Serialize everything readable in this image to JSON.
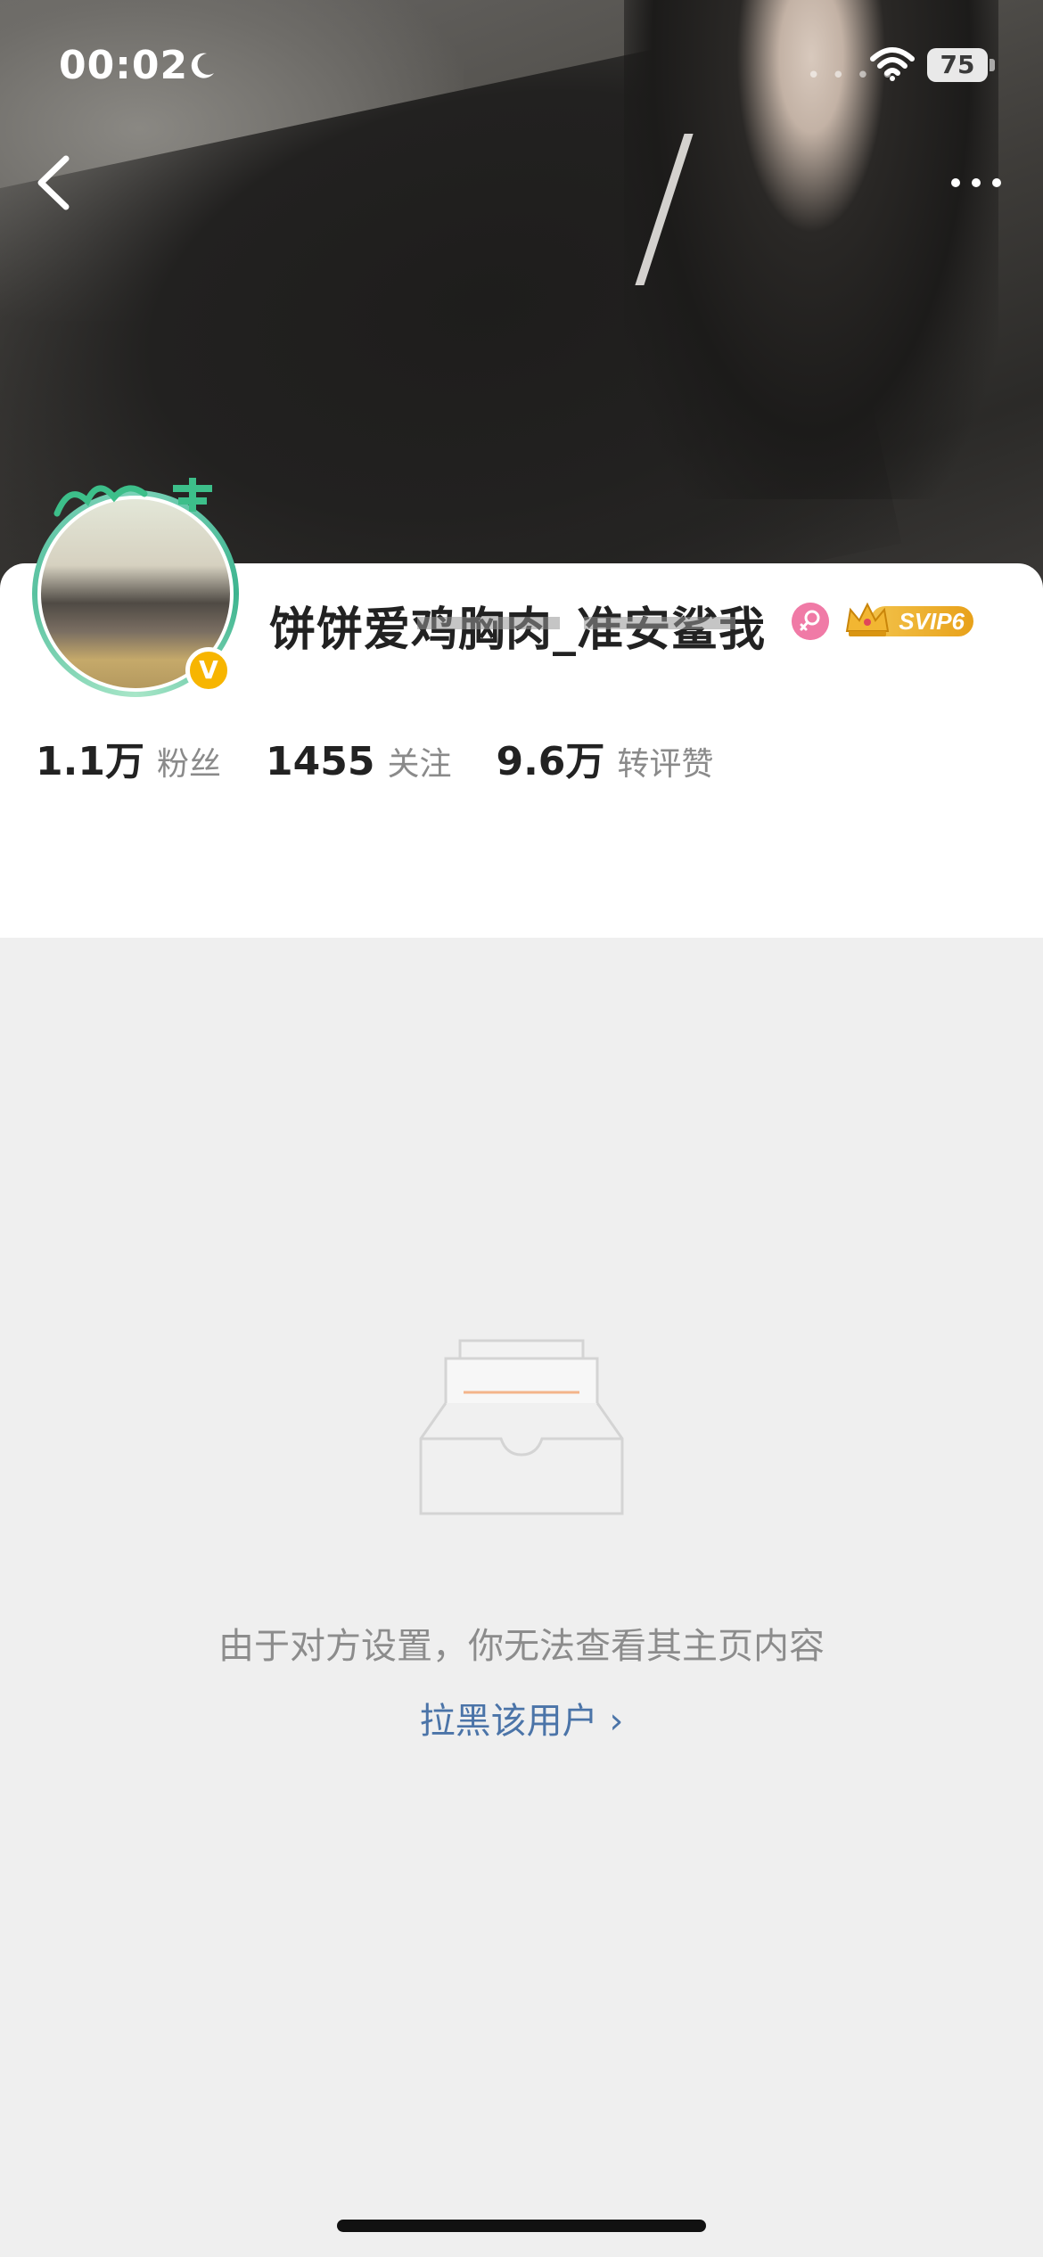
{
  "status_bar": {
    "time": "00:02",
    "battery": "75"
  },
  "profile": {
    "username": "饼饼爱鸡胸肉_准安鲨我",
    "vip_label": "SVIP6",
    "stats": [
      {
        "value": "1.1万",
        "label": "粉丝"
      },
      {
        "value": "1455",
        "label": "关注"
      },
      {
        "value": "9.6万",
        "label": "转评赞"
      }
    ]
  },
  "empty_state": {
    "message": "由于对方设置，你无法查看其主页内容",
    "action": "拉黑该用户 ›"
  },
  "colors": {
    "link": "#4b74a8",
    "verified": "#f7b500",
    "gender_female": "#f07aa6",
    "vip_gold": "#e8a11a"
  },
  "icons": [
    "moon-icon",
    "wifi-icon",
    "battery-icon",
    "back-icon",
    "more-icon",
    "verified-icon",
    "female-icon",
    "vip-crown-icon",
    "empty-box-icon"
  ]
}
